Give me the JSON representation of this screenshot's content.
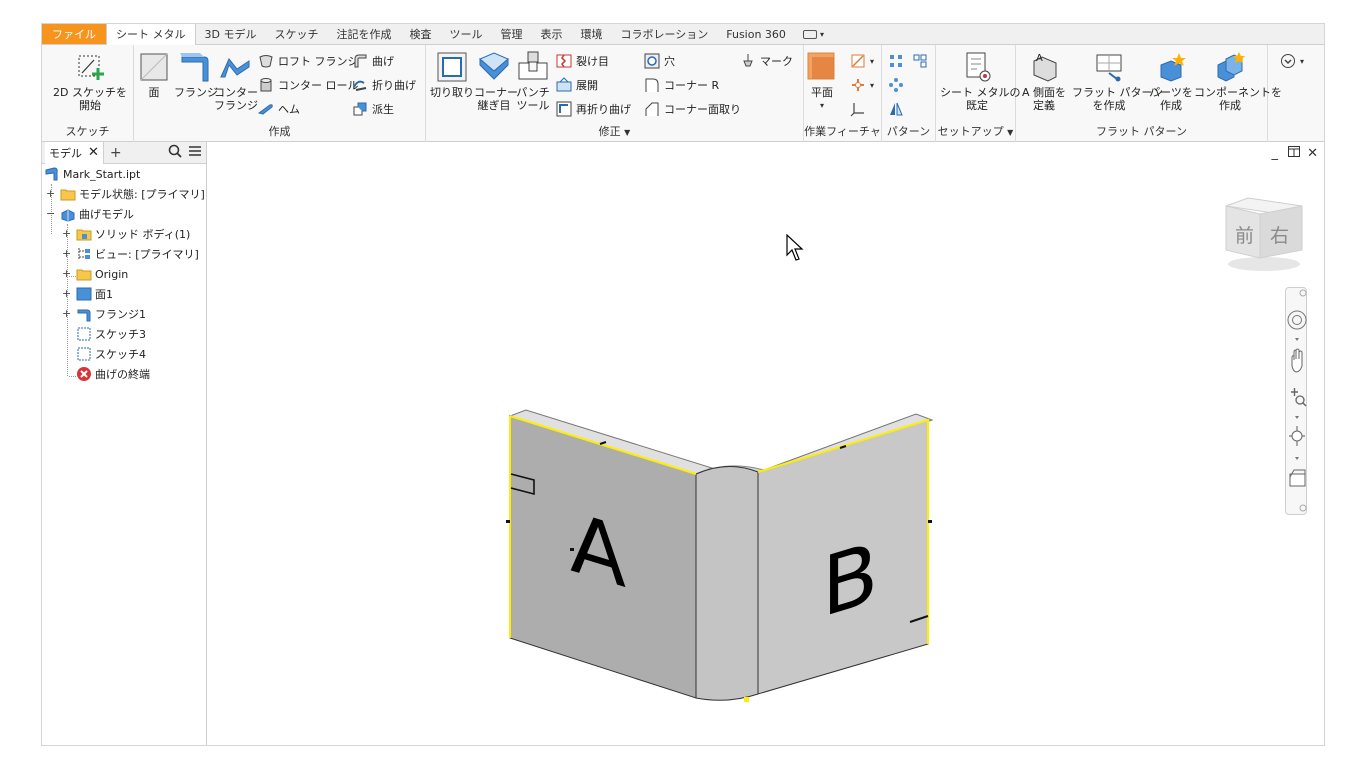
{
  "tabs": {
    "file": "ファイル",
    "sheet_metal": "シート メタル",
    "model_3d": "3D モデル",
    "sketch": "スケッチ",
    "annotate": "注記を作成",
    "inspect": "検査",
    "tools": "ツール",
    "manage": "管理",
    "view": "表示",
    "environments": "環境",
    "collaborate": "コラボレーション",
    "fusion": "Fusion 360"
  },
  "ribbon": {
    "sketch_panel": {
      "title": "スケッチ",
      "start_sketch_line1": "2D スケッチを",
      "start_sketch_line2": "開始"
    },
    "create_panel": {
      "title": "作成",
      "face": "面",
      "flange": "フランジ",
      "contour_flange_line1": "コンター",
      "contour_flange_line2": "フランジ",
      "lofted_flange": "ロフト フランジ",
      "contour_roll": "コンター ロール",
      "hem": "ヘム",
      "bend": "曲げ",
      "fold": "折り曲げ",
      "derive": "派生"
    },
    "modify_panel": {
      "title": "修正",
      "cut": "切り取り",
      "corner_seam_line1": "コーナー",
      "corner_seam_line2": "継ぎ目",
      "punch_line1": "パンチ",
      "punch_line2": "ツール",
      "rip": "裂け目",
      "unfold": "展開",
      "refold": "再折り曲げ",
      "hole": "穴",
      "corner_round": "コーナー R",
      "corner_chamfer": "コーナー面取り",
      "mark": "マーク"
    },
    "work_panel": {
      "title": "作業フィーチャ",
      "plane": "平面"
    },
    "pattern_panel": {
      "title": "パターン"
    },
    "setup_panel": {
      "title": "セットアップ",
      "defaults_line1": "シート メタルの",
      "defaults_line2": "既定"
    },
    "flat_panel": {
      "title": "フラット パターン",
      "define_a_line1": "A 側面を",
      "define_a_line2": "定義",
      "create_flat_line1": "フラット パターン",
      "create_flat_line2": "を作成",
      "make_parts_line1": "パーツを",
      "make_parts_line2": "作成",
      "make_comp_line1": "コンポーネントを",
      "make_comp_line2": "作成"
    }
  },
  "browser": {
    "tab": "モデル",
    "items": [
      "Mark_Start.ipt",
      "モデル状態: [プライマリ]",
      "曲げモデル",
      "ソリッド ボディ(1)",
      "ビュー: [プライマリ]",
      "Origin",
      "面1",
      "フランジ1",
      "スケッチ3",
      "スケッチ4",
      "曲げの終端"
    ]
  },
  "model": {
    "face_a": "A",
    "face_b": "B"
  },
  "viewcube": {
    "front": "前",
    "right": "右"
  },
  "colors": {
    "file_tab": "#f7941d",
    "edge_highlight": "#ffee00",
    "face_left": "#adadad",
    "face_right": "#c8c8c8"
  }
}
